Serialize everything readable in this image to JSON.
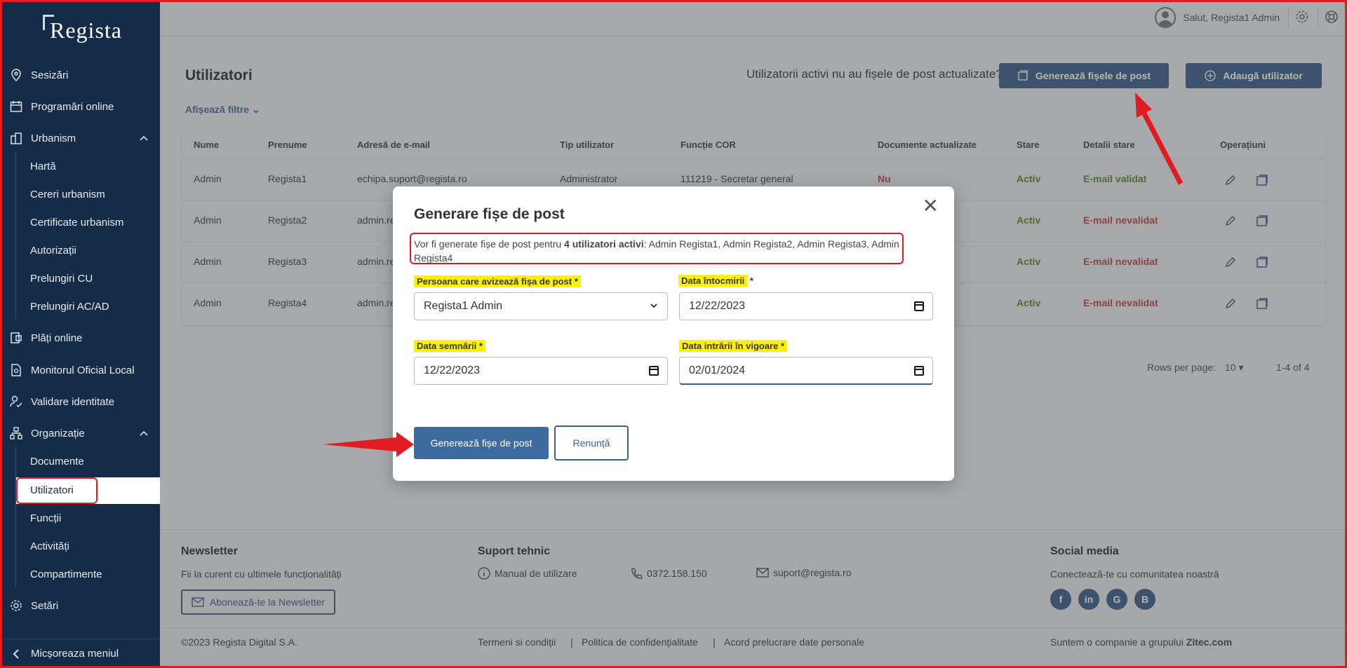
{
  "sidebar": {
    "logo": "Regista",
    "items": [
      {
        "label": "Sesizări",
        "icon": "map-pin-icon"
      },
      {
        "label": "Programări online",
        "icon": "calendar-icon"
      },
      {
        "label": "Urbanism",
        "icon": "building-icon"
      },
      {
        "label": "Plăți online",
        "icon": "payment-icon"
      },
      {
        "label": "Monitorul Oficial Local",
        "icon": "document-badge-icon"
      },
      {
        "label": "Validare identitate",
        "icon": "user-check-icon"
      },
      {
        "label": "Organizație",
        "icon": "org-chart-icon"
      },
      {
        "label": "Setări",
        "icon": "gear-icon"
      }
    ],
    "urbanism_sub": [
      "Hartă",
      "Cereri urbanism",
      "Certificate urbanism",
      "Autorizații",
      "Prelungiri CU",
      "Prelungiri AC/AD"
    ],
    "organizatie_sub": [
      "Documente",
      "Utilizatori",
      "Funcții",
      "Activități",
      "Compartimente"
    ],
    "collapse_label": "Micșoreaza meniul"
  },
  "topbar": {
    "greeting": "Salut, Regista1 Admin"
  },
  "page": {
    "title": "Utilizatori",
    "filters_label": "Afișează filtre",
    "question": "Utilizatorii activi nu au fișele de post actualizate?",
    "generate_button": "Generează fișele de post",
    "add_button": "Adaugă utilizator"
  },
  "table": {
    "headers": [
      "Nume",
      "Prenume",
      "Adresă de e-mail",
      "Tip utilizator",
      "Funcție COR",
      "Documente actualizate",
      "Stare",
      "Detalii stare",
      "Operațiuni"
    ],
    "rows": [
      {
        "nume": "Admin",
        "prenume": "Regista1",
        "email": "echipa.suport@regista.ro",
        "tip": "Administrator",
        "functie": "111219 - Secretar general",
        "doc": "Nu",
        "stare": "Activ",
        "detalii": "E-mail validat"
      },
      {
        "nume": "Admin",
        "prenume": "Regista2",
        "email": "admin.re",
        "tip": "",
        "functie": "",
        "doc": "",
        "stare": "Activ",
        "detalii": "E-mail nevalidat"
      },
      {
        "nume": "Admin",
        "prenume": "Regista3",
        "email": "admin.re",
        "tip": "",
        "functie": "",
        "doc": "",
        "stare": "Activ",
        "detalii": "E-mail nevalidat"
      },
      {
        "nume": "Admin",
        "prenume": "Regista4",
        "email": "admin.re",
        "tip": "",
        "functie": "",
        "doc": "",
        "stare": "Activ",
        "detalii": "E-mail nevalidat"
      }
    ],
    "rows_per_page_label": "Rows per page:",
    "rows_per_page_value": "10",
    "range": "1-4 of 4"
  },
  "footer": {
    "newsletter_title": "Newsletter",
    "newsletter_text": "Fii la curent cu ultimele funcționalități",
    "newsletter_button": "Abonează-te la Newsletter",
    "support_title": "Suport tehnic",
    "manual": "Manual de utilizare",
    "phone": "0372.158.150",
    "email": "suport@regista.ro",
    "social_title": "Social media",
    "social_text": "Conectează-te cu comunitatea noastră",
    "copyright": "©2023 Regista Digital S.A.",
    "links": [
      "Termeni si condiții",
      "Politica de confidențialitate",
      "Acord prelucrare date personale"
    ],
    "group_prefix": "Suntem o companie a grupului",
    "group_name": "Zitec.com"
  },
  "modal": {
    "title": "Generare fișe de post",
    "info_prefix": "Vor fi generate fișe de post pentru",
    "info_bold": "4 utilizatori activi",
    "info_suffix": ": Admin Regista1, Admin Regista2, Admin Regista3, Admin Regista4",
    "avizeaza_label": "Persoana care avizează fișa de post *",
    "avizeaza_value": "Regista1 Admin",
    "intocmire_label": "Data întocmirii",
    "intocmire_value": "12/22/2023",
    "semnare_label": "Data semnării *",
    "semnare_value": "12/22/2023",
    "vigoare_label": "Data intrării în vigoare *",
    "vigoare_value": "02/01/2024",
    "primary_button": "Generează fișe de post",
    "cancel_button": "Renunță"
  },
  "colors": {
    "sidebar_bg": "#142c48",
    "accent": "#3d5f8c",
    "annotation_red": "#e11b22",
    "highlight": "#fff200"
  }
}
